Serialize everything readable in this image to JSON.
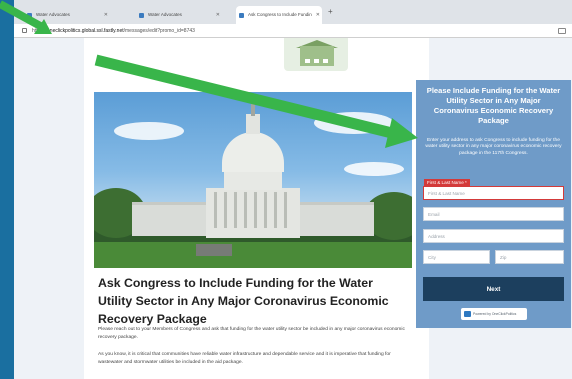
{
  "browser": {
    "tabs": [
      {
        "label": "Water Advocates",
        "active": false
      },
      {
        "label": "Water Advocates",
        "active": false
      },
      {
        "label": "Ask Congress to Include Fundin",
        "active": true
      }
    ],
    "url_prefix": "https://",
    "url_domain": "oneclickpolitics.global.ssl.fastly.net",
    "url_path": "/messages/edit?promo_id=8743"
  },
  "article": {
    "title": "Ask Congress to Include Funding for the Water Utility Sector in Any Major Coronavirus Economic Recovery Package",
    "paragraphs": [
      "Please reach out to your Members of Congress and ask that funding for the water utility sector be included in any major coronavirus economic recovery package.",
      "As you know, it is critical that communities have reliable water infrastructure and dependable service and it is imperative that funding for wastewater and stormwater utilities be included in the aid package."
    ]
  },
  "form": {
    "title": "Please Include Funding for the Water Utility Sector in Any Major Coronavirus Economic Recovery Package",
    "description": "Enter your address to ask Congress to include funding for the water utility sector in any major coronavirus economic recovery package in the 117th Congress.",
    "name_label": "First & Last Name *",
    "name_placeholder": "First & Last Name",
    "email_placeholder": "Email",
    "address_placeholder": "Address",
    "city_placeholder": "City",
    "zip_placeholder": "Zip",
    "next_label": "Next",
    "powered_by": "Powered by OneClickPolitics"
  },
  "colors": {
    "frame": "#1a6fa0",
    "arrow": "#39b54a",
    "form_panel": "#6f9bc8",
    "next_button": "#1c3f5e",
    "error_red": "#d33a3a"
  },
  "icons": [
    "lock-icon",
    "close-icon",
    "plus-icon",
    "extension-icon",
    "logo-icon",
    "arrow-icon"
  ]
}
